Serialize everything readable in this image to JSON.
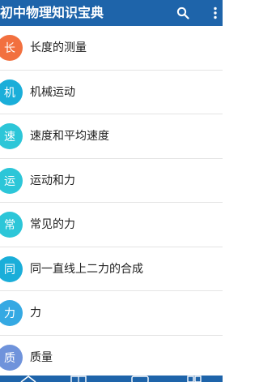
{
  "app": {
    "title": "初中物理知识宝典"
  },
  "toolbar": {
    "search_icon": "search-icon",
    "more_icon": "more-vert-icon"
  },
  "colors": {
    "appbar": "#1e64aa",
    "badge_orange": "#f2703f",
    "badge_blue": "#1aaed9",
    "badge_cyan": "#2cc6d8",
    "badge_sky": "#35a9e3",
    "badge_periwinkle": "#6f93db"
  },
  "topics": [
    {
      "initial": "长",
      "label": "长度的测量",
      "color": "#f2703f"
    },
    {
      "initial": "机",
      "label": "机械运动",
      "color": "#1aaed9"
    },
    {
      "initial": "速",
      "label": "速度和平均速度",
      "color": "#2cc6d8"
    },
    {
      "initial": "运",
      "label": "运动和力",
      "color": "#2cc6d8"
    },
    {
      "initial": "常",
      "label": "常见的力",
      "color": "#2cc6d8"
    },
    {
      "initial": "同",
      "label": "同一直线上二力的合成",
      "color": "#1aaed9"
    },
    {
      "initial": "力",
      "label": "力",
      "color": "#35a9e3"
    },
    {
      "initial": "质",
      "label": "质量",
      "color": "#6f93db"
    }
  ],
  "bottom_tabs": [
    {
      "icon": "home-icon"
    },
    {
      "icon": "book-icon"
    },
    {
      "icon": "chat-icon"
    },
    {
      "icon": "grid-icon"
    }
  ]
}
